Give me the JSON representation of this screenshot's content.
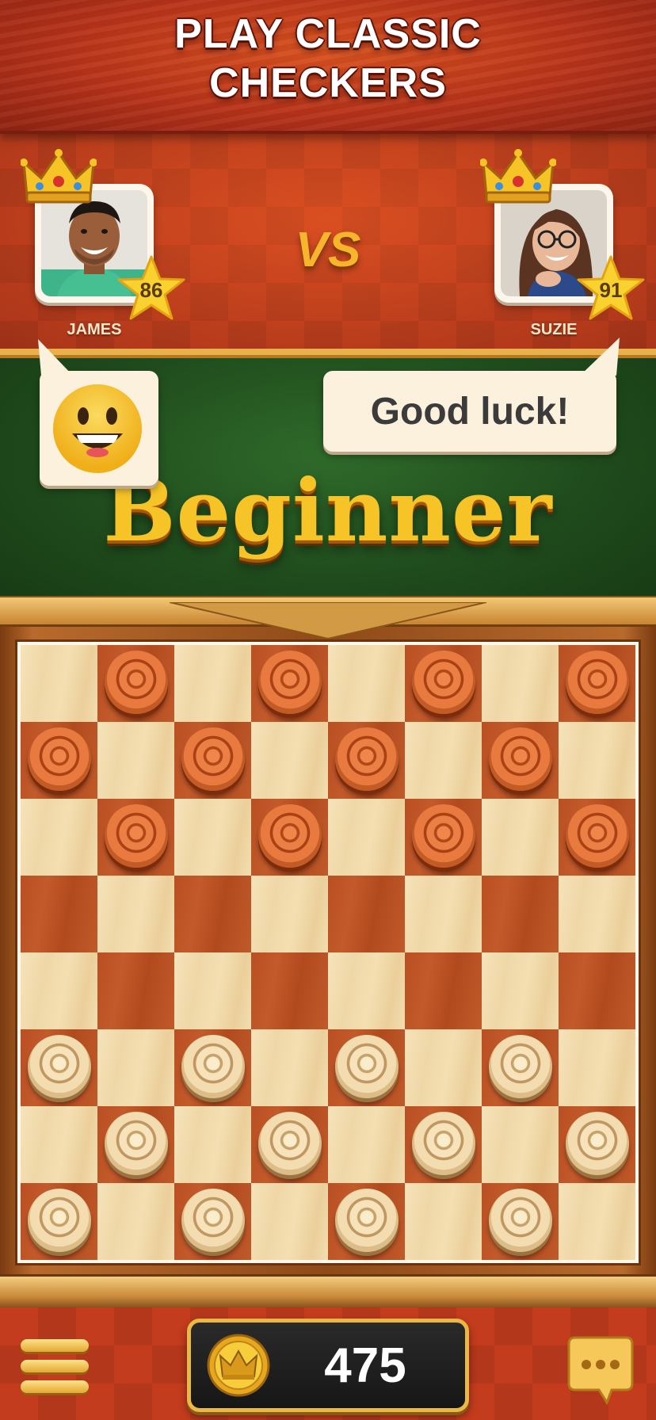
{
  "header": {
    "title_line1": "PLAY CLASSIC",
    "title_line2": "CHECKERS"
  },
  "players": {
    "left": {
      "name": "JAMES",
      "level": "86"
    },
    "right": {
      "name": "SUZIE",
      "level": "91"
    },
    "vs_label": "VS"
  },
  "banner": {
    "level_label": "Beginner",
    "left_bubble_icon": "grinning-face-emoji",
    "chat_message": "Good luck!"
  },
  "board": {
    "size": 8,
    "rows": [
      ". r . r . r . r",
      "r . r . r . r .",
      ". r . r . r . r",
      ". . . . . . . .",
      ". . . . . . . .",
      "w . w . w . w .",
      ". w . w . w . w",
      "w . w . w . w ."
    ],
    "colors": {
      "red_piece": "#e87a3f",
      "white_piece": "#f3dcb0",
      "dark_square": "#b94f22",
      "light_square": "#f6e3ba"
    }
  },
  "bottom_bar": {
    "menu_icon": "hamburger-menu-icon",
    "coin_icon": "crown-coin-icon",
    "coins": "475",
    "chat_icon": "chat-ellipsis-icon"
  },
  "colors": {
    "accent_gold": "#f7c428",
    "header_red": "#b8331a",
    "banner_green": "#1f4a1c"
  }
}
